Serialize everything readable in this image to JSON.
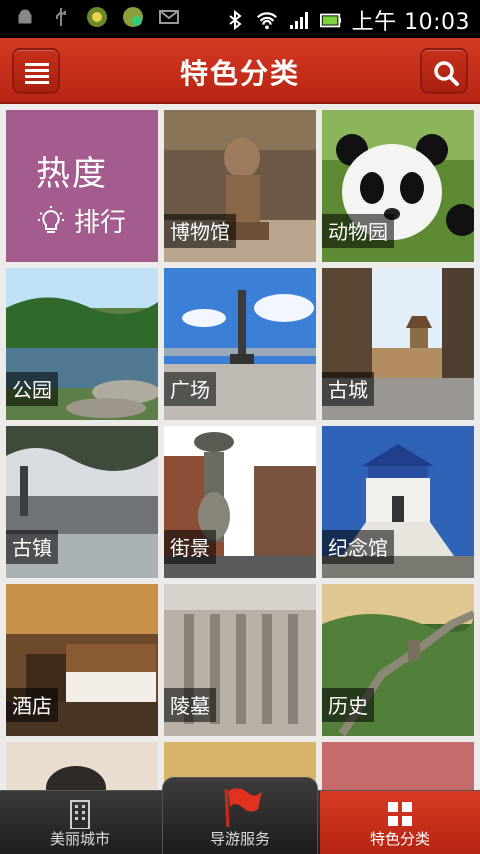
{
  "status_bar": {
    "time": "上午 10:03",
    "icons": [
      "android-debug-icon",
      "usb-icon",
      "app-notification-icon",
      "app-notification-icon-2",
      "mail-icon",
      "bluetooth-icon",
      "wifi-icon",
      "signal-icon",
      "battery-icon"
    ]
  },
  "header": {
    "title": "特色分类",
    "menu_icon": "menu-icon",
    "search_icon": "search-icon"
  },
  "grid": {
    "hot_ranking": {
      "title": "热度",
      "subtitle": "排行",
      "icon": "lightbulb-icon"
    },
    "categories": [
      {
        "label": "博物馆"
      },
      {
        "label": "动物园"
      },
      {
        "label": "公园"
      },
      {
        "label": "广场"
      },
      {
        "label": "古城"
      },
      {
        "label": "古镇"
      },
      {
        "label": "街景"
      },
      {
        "label": "纪念馆"
      },
      {
        "label": "酒店"
      },
      {
        "label": "陵墓"
      },
      {
        "label": "历史"
      }
    ]
  },
  "bottom_nav": {
    "items": [
      {
        "label": "美丽城市",
        "icon": "city-building-icon",
        "active": false
      },
      {
        "label": "导游服务",
        "icon": "flag-icon",
        "active": false
      },
      {
        "label": "特色分类",
        "icon": "grid-icon",
        "active": true
      }
    ]
  },
  "colors": {
    "header_red": "#c62d1a",
    "hot_tile": "#a45b8e",
    "background": "#ecebea"
  }
}
